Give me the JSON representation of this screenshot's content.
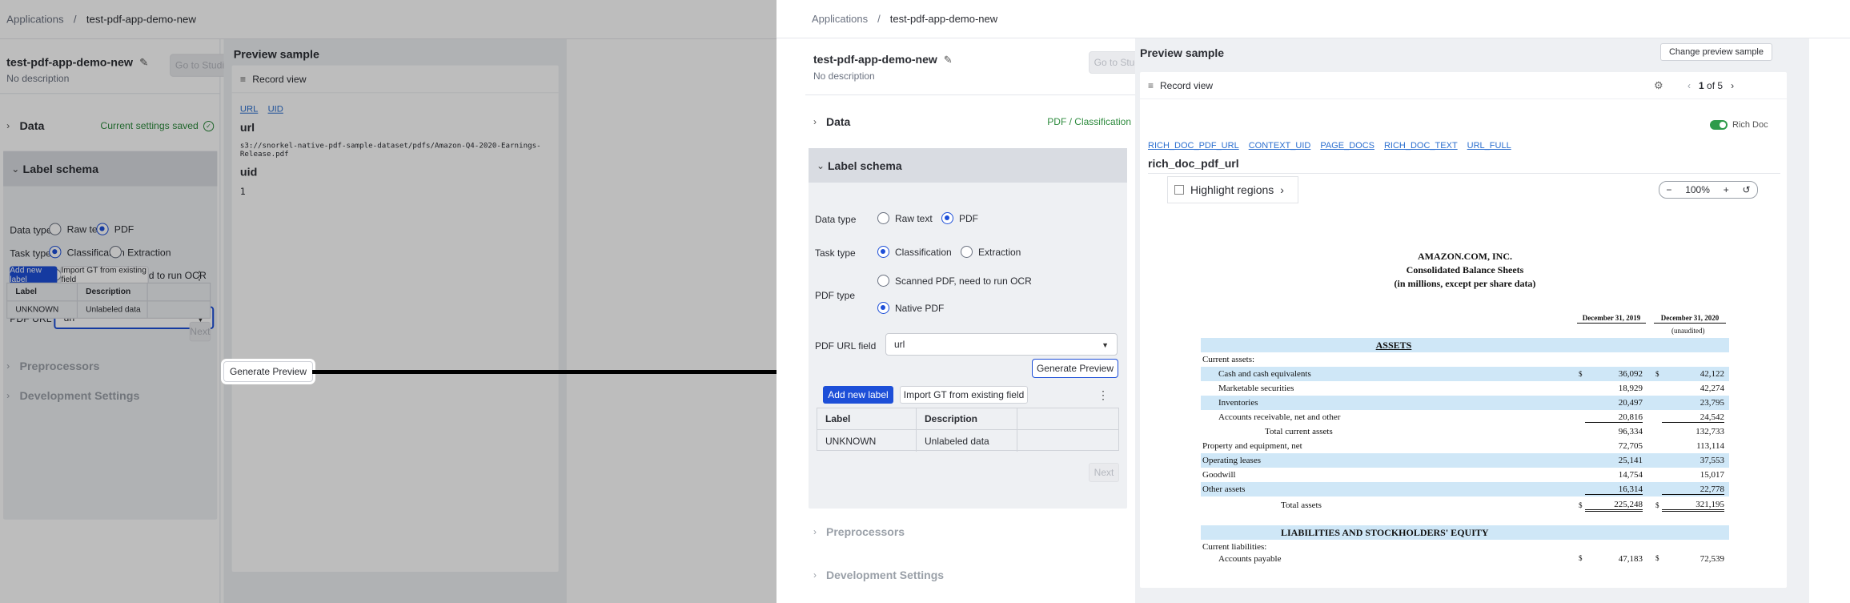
{
  "breadcrumb": {
    "root": "Applications",
    "separator": "/",
    "current": "test-pdf-app-demo-new"
  },
  "app": {
    "name": "test-pdf-app-demo-new",
    "description": "No description",
    "studio_button": "Go to Studio"
  },
  "data_section": {
    "title": "Data",
    "status_left": "Current settings saved",
    "status_right": "PDF / Classification"
  },
  "label_schema": {
    "title": "Label schema",
    "data_type_label": "Data type",
    "data_type_options": [
      "Raw text",
      "PDF"
    ],
    "data_type_selected": "PDF",
    "task_type_label": "Task type",
    "task_type_options": [
      "Classification",
      "Extraction"
    ],
    "task_type_selected": "Classification",
    "pdf_type_label": "PDF type",
    "pdf_type_options": [
      "Scanned PDF, need to run OCR",
      "Native PDF"
    ],
    "pdf_type_selected": "Native PDF",
    "pdf_url_label": "PDF URL field",
    "pdf_url_value": "url",
    "generate_button": "Generate Preview",
    "add_label_button": "Add new label",
    "import_button": "Import GT from existing field",
    "table_headers": [
      "Label",
      "Description"
    ],
    "table_rows": [
      [
        "UNKNOWN",
        "Unlabeled data"
      ]
    ],
    "next_button": "Next"
  },
  "collapsed_sections": [
    "Preprocessors",
    "Development Settings"
  ],
  "preview_left": {
    "title": "Preview sample",
    "record_view": "Record view",
    "field_links": [
      "URL",
      "UID"
    ],
    "field1_name": "url",
    "field1_value": "s3://snorkel-native-pdf-sample-dataset/pdfs/Amazon-Q4-2020-Earnings-Release.pdf",
    "field2_name": "uid",
    "field2_value": "1"
  },
  "preview_right": {
    "title": "Preview sample",
    "change_button": "Change preview sample",
    "record_view": "Record view",
    "pager_current": "1",
    "pager_of": "of",
    "pager_total": "5",
    "rich_doc_toggle": "Rich Doc",
    "field_links": [
      "RICH_DOC_PDF_URL",
      "CONTEXT_UID",
      "PAGE_DOCS",
      "RICH_DOC_TEXT",
      "URL_FULL"
    ],
    "field_name": "rich_doc_pdf_url",
    "highlight_button": "Highlight regions",
    "zoom_level": "100%"
  },
  "pdf_doc": {
    "heading1": "AMAZON.COM, INC.",
    "heading2": "Consolidated Balance Sheets",
    "heading3": "(in millions, except per share data)",
    "col1": "December 31, 2019",
    "col2": "December 31, 2020",
    "unaudited": "(unaudited)",
    "assets_heading": "ASSETS",
    "current_assets": "Current assets:",
    "rows": [
      {
        "label": "Cash and cash equivalents",
        "v1": "36,092",
        "v2": "42,122"
      },
      {
        "label": "Marketable securities",
        "v1": "18,929",
        "v2": "42,274"
      },
      {
        "label": "Inventories",
        "v1": "20,497",
        "v2": "23,795"
      },
      {
        "label": "Accounts receivable, net and other",
        "v1": "20,816",
        "v2": "24,542"
      },
      {
        "label": "Total current assets",
        "v1": "96,334",
        "v2": "132,733"
      },
      {
        "label": "Property and equipment, net",
        "v1": "72,705",
        "v2": "113,114"
      },
      {
        "label": "Operating leases",
        "v1": "25,141",
        "v2": "37,553"
      },
      {
        "label": "Goodwill",
        "v1": "14,754",
        "v2": "15,017"
      },
      {
        "label": "Other assets",
        "v1": "16,314",
        "v2": "22,778"
      },
      {
        "label": "Total assets",
        "v1": "225,248",
        "v2": "321,195"
      }
    ],
    "liabilities_heading": "LIABILITIES AND STOCKHOLDERS' EQUITY",
    "current_liabilities": "Current liabilities:",
    "last_row": {
      "label": "Accounts payable",
      "v1": "47,183",
      "v2": "72,539"
    },
    "dollar": "$"
  },
  "icons": {
    "pencil": "pencil-icon",
    "check": "check-circle-icon",
    "chevron": "chevron-right-icon",
    "gear": "gear-icon",
    "menu": "menu-lines-icon"
  }
}
